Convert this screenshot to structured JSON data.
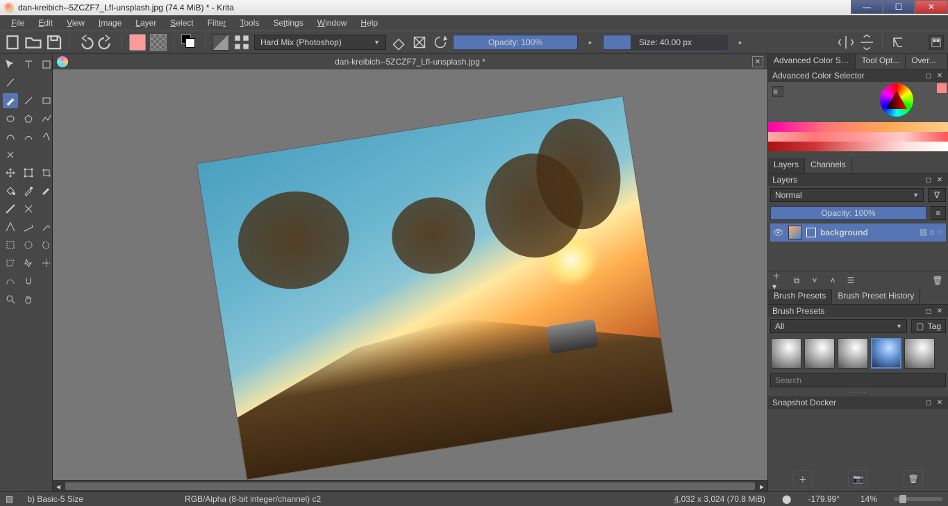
{
  "titlebar": {
    "text": "dan-kreibich--5ZCZF7_LfI-unsplash.jpg (74.4 MiB) * - Krita"
  },
  "menubar": {
    "file": "File",
    "edit": "Edit",
    "view": "View",
    "image": "Image",
    "layer": "Layer",
    "select": "Select",
    "filter": "Filter",
    "tools": "Tools",
    "settings": "Settings",
    "window": "Window",
    "help": "Help"
  },
  "toolbar": {
    "blend_mode": "Hard Mix (Photoshop)",
    "opacity_label": "Opacity:  100%",
    "size_label": "Size: 40.00 px"
  },
  "document": {
    "tab_title": "dan-kreibich--5ZCZF7_LfI-unsplash.jpg *"
  },
  "dockers": {
    "top_tabs": {
      "acs": "Advanced Color Sele...",
      "toolopts": "Tool Opt...",
      "overview": "Over..."
    },
    "acs_header": "Advanced Color Selector",
    "layers_tab": "Layers",
    "channels_tab": "Channels",
    "layers_header": "Layers",
    "blend_mode": "Normal",
    "layer_opacity_label": "Opacity:   100%",
    "layer_name": "background",
    "brush_presets_tab": "Brush Presets",
    "brush_history_tab": "Brush Preset History",
    "brush_presets_header": "Brush Presets",
    "filter_all": "All",
    "tag_label": "Tag",
    "search_placeholder": "Search",
    "snapshot_header": "Snapshot Docker"
  },
  "statusbar": {
    "selection_icon": "",
    "brush_preset": "b)  Basic-5 Size",
    "color_model": "RGB/Alpha (8-bit integer/channel)  c2",
    "dimensions": "4,032 x 3,024 (70.8 MiB)",
    "rotation": "-179.99°",
    "zoom": "14%"
  }
}
